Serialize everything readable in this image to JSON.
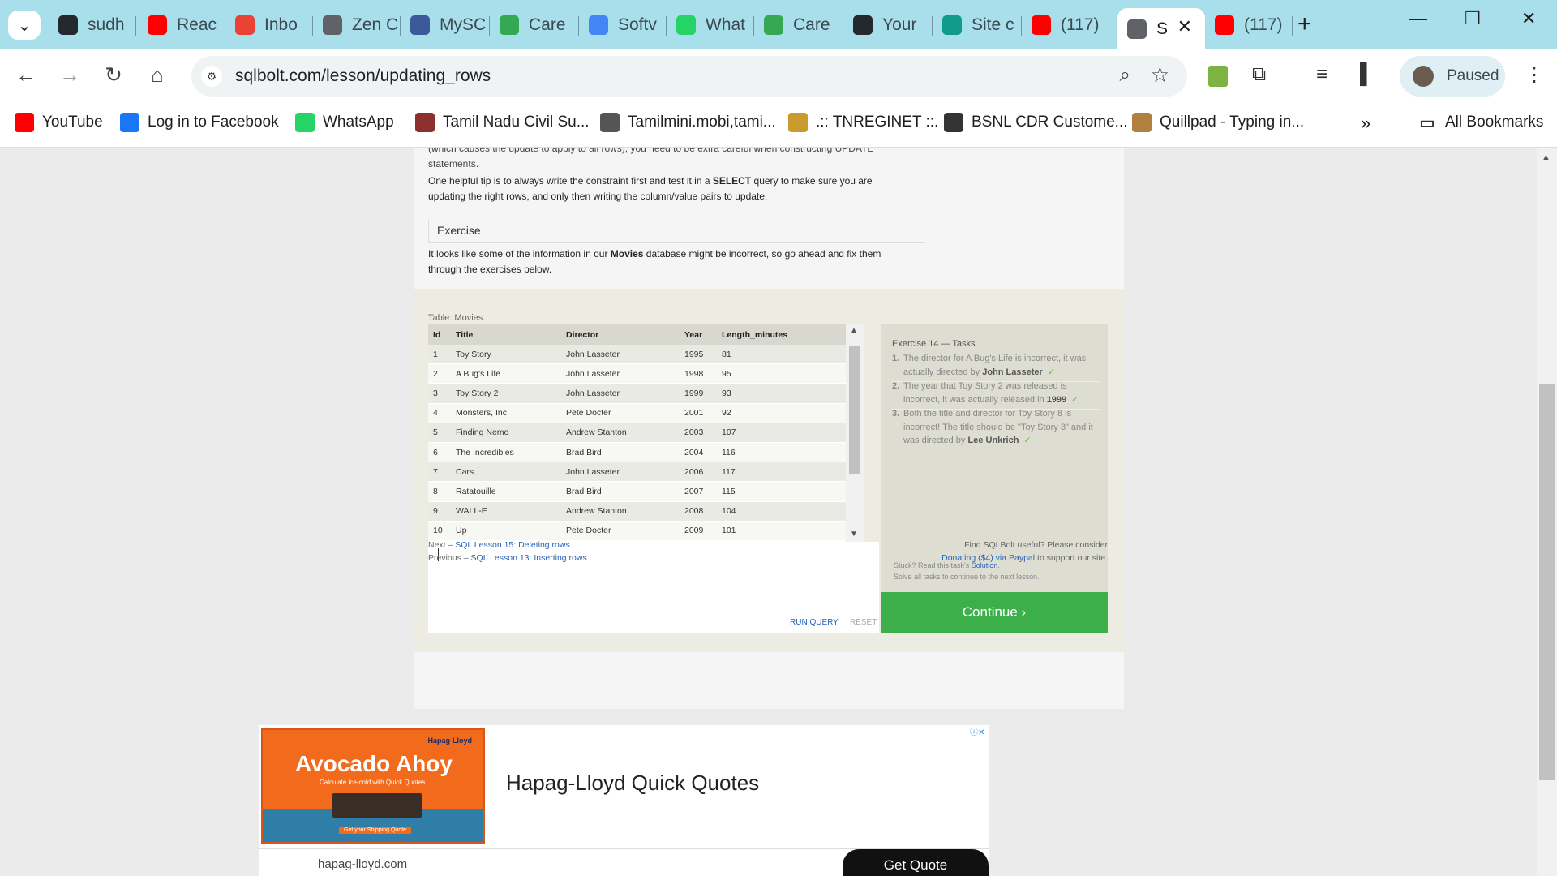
{
  "tabs": [
    {
      "label": "sudh",
      "icon": "github-icon",
      "color": "#24292f"
    },
    {
      "label": "Reac",
      "icon": "youtube-icon",
      "color": "#ff0000"
    },
    {
      "label": "Inbo",
      "icon": "gmail-icon",
      "color": "#ea4335"
    },
    {
      "label": "Zen C",
      "icon": "classroom-icon",
      "color": "#5f6368"
    },
    {
      "label": "MySC",
      "icon": "mysql-icon",
      "color": "#3c5a99"
    },
    {
      "label": "Care",
      "icon": "careers-icon",
      "color": "#34a853"
    },
    {
      "label": "Softv",
      "icon": "docs-icon",
      "color": "#4285f4"
    },
    {
      "label": "What",
      "icon": "whatsapp-icon",
      "color": "#25d366"
    },
    {
      "label": "Care",
      "icon": "careers-icon",
      "color": "#34a853"
    },
    {
      "label": "Your",
      "icon": "github-icon",
      "color": "#24292f"
    },
    {
      "label": "Site c",
      "icon": "site-icon",
      "color": "#0f9d8a"
    },
    {
      "label": "(117)",
      "icon": "youtube-icon",
      "color": "#ff0000"
    },
    {
      "label": "S",
      "icon": "database-icon",
      "color": "#5f6368",
      "active": true
    },
    {
      "label": "(117)",
      "icon": "youtube-icon",
      "color": "#ff0000"
    }
  ],
  "toolbar": {
    "url": "sqlbolt.com/lesson/updating_rows",
    "profile_label": "Paused"
  },
  "bookmarks": [
    {
      "label": "YouTube",
      "icon": "youtube-icon",
      "color": "#ff0000"
    },
    {
      "label": "Log in to Facebook",
      "icon": "facebook-icon",
      "color": "#1877f2"
    },
    {
      "label": "WhatsApp",
      "icon": "whatsapp-icon",
      "color": "#25d366"
    },
    {
      "label": "Tamil Nadu Civil Su...",
      "icon": "tn-civil-icon",
      "color": "#8b2f2f"
    },
    {
      "label": "Tamilmini.mobi,tami...",
      "icon": "tamilmini-icon",
      "color": "#555555"
    },
    {
      "label": ".:: TNREGINET ::.",
      "icon": "tnreginet-icon",
      "color": "#c99a2e"
    },
    {
      "label": "BSNL CDR Custome...",
      "icon": "globe-icon",
      "color": "#333333"
    },
    {
      "label": "Quillpad - Typing in...",
      "icon": "quillpad-icon",
      "color": "#b08040"
    }
  ],
  "all_bookmarks_label": "All Bookmarks",
  "lesson": {
    "cut_top_text": "(which causes the update to apply to all rows), you need to be extra careful when constructing UPDATE",
    "cut_top_text2": "statements.",
    "tip_prefix": "One helpful tip is to always write the constraint first and test it in a ",
    "tip_select": "SELECT",
    "tip_suffix": " query to make sure you are",
    "tip_line2": "updating the right rows, and only then writing the column/value pairs to update.",
    "exercise_heading": "Exercise",
    "exercise_prefix": "It looks like some of the information in our ",
    "exercise_bold": "Movies",
    "exercise_suffix": " database might be incorrect, so go ahead and fix them",
    "exercise_line2": "through the exercises below."
  },
  "table": {
    "label": "Table: Movies",
    "columns": [
      "Id",
      "Title",
      "Director",
      "Year",
      "Length_minutes"
    ],
    "rows": [
      [
        "1",
        "Toy Story",
        "John Lasseter",
        "1995",
        "81"
      ],
      [
        "2",
        "A Bug's Life",
        "John Lasseter",
        "1998",
        "95"
      ],
      [
        "3",
        "Toy Story 2",
        "John Lasseter",
        "1999",
        "93"
      ],
      [
        "4",
        "Monsters, Inc.",
        "Pete Docter",
        "2001",
        "92"
      ],
      [
        "5",
        "Finding Nemo",
        "Andrew Stanton",
        "2003",
        "107"
      ],
      [
        "6",
        "The Incredibles",
        "Brad Bird",
        "2004",
        "116"
      ],
      [
        "7",
        "Cars",
        "John Lasseter",
        "2006",
        "117"
      ],
      [
        "8",
        "Ratatouille",
        "Brad Bird",
        "2007",
        "115"
      ],
      [
        "9",
        "WALL-E",
        "Andrew Stanton",
        "2008",
        "104"
      ],
      [
        "10",
        "Up",
        "Pete Docter",
        "2009",
        "101"
      ]
    ]
  },
  "editor": {
    "run_label": "RUN QUERY",
    "reset_label": "RESET"
  },
  "tasks": {
    "title": "Exercise 14 — Tasks",
    "items": [
      {
        "num": "1.",
        "text": "The director for A Bug's Life is incorrect, it was actually directed by ",
        "bold": "John Lasseter"
      },
      {
        "num": "2.",
        "text": "The year that Toy Story 2 was released is incorrect, it was actually released in ",
        "bold": "1999"
      },
      {
        "num": "3.",
        "text": "Both the title and director for Toy Story 8 is incorrect! The title should be \"Toy Story 3\" and it was directed by ",
        "bold": "Lee Unkrich"
      }
    ],
    "stuck_prefix": "Stuck? Read this task's ",
    "stuck_link": "Solution",
    "stuck_suffix": ".",
    "solve_all": "Solve all tasks to continue to the next lesson.",
    "continue_label": "Continue ›"
  },
  "footer_nav": {
    "next_prefix": "Next – ",
    "next_link": "SQL Lesson 15: Deleting rows",
    "prev_prefix": "Previous – ",
    "prev_link": "SQL Lesson 13: Inserting rows",
    "support_line1": "Find SQLBolt useful? Please consider",
    "support_link": "Donating ($4) via Paypal",
    "support_suffix": " to support our site."
  },
  "ad": {
    "image_headline": "Avocado Ahoy",
    "image_brand": "Hapag-Lloyd",
    "image_sub": "Calculate ice-cold with Quick Quotes",
    "image_cta": "Get your Shipping Quote",
    "headline": "Hapag-Lloyd Quick Quotes",
    "domain": "hapag-lloyd.com",
    "button": "Get Quote"
  }
}
